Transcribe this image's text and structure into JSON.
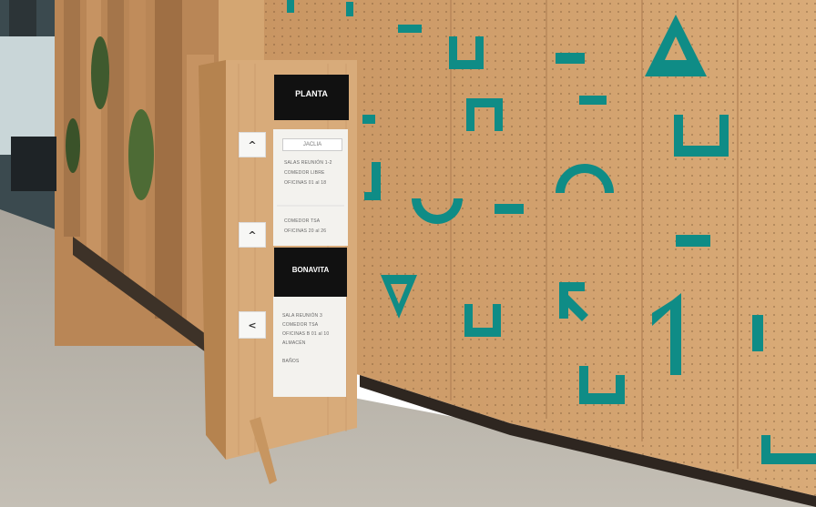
{
  "sign": {
    "header_top": "PLANTA",
    "panel_top_title": "JACLIA",
    "panel_top_items": [
      "SALAS REUNIÓN 1-2",
      "COMEDOR LIBRE",
      "OFICINAS 01 al 18"
    ],
    "panel_mid_items": [
      "COMEDOR TSA",
      "OFICINAS 20 al 26"
    ],
    "header_bottom": "BONAVITA",
    "panel_bottom_items": [
      "SALA REUNIÓN 3",
      "COMEDOR TSA",
      "OFICINAS B 01 al 10",
      "ALMACÉN",
      "BAÑOS"
    ],
    "arrows": [
      "^",
      "^",
      "<"
    ]
  },
  "colors": {
    "wood": "#d2a06e",
    "teal": "#0f8c86",
    "sign_black": "#111111",
    "floor": "#b9b3a9"
  }
}
